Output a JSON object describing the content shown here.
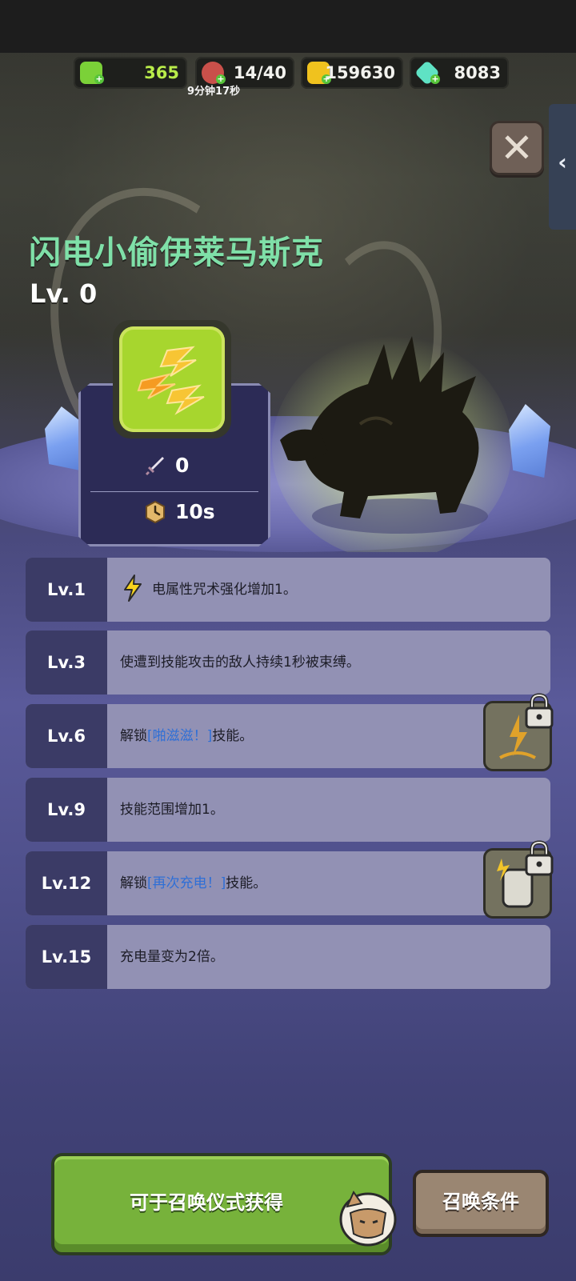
{
  "resources": {
    "energy": {
      "value": "365",
      "icon": "green-energy-icon",
      "color": "#b9ec4a"
    },
    "meat": {
      "value": "14/40",
      "icon": "meat-icon",
      "timer": "9分钟17秒"
    },
    "gold": {
      "value": "159630",
      "icon": "gold-icon"
    },
    "gems": {
      "value": "8083",
      "icon": "gem-icon"
    }
  },
  "close_label": "✕",
  "side_tab_label": "‹",
  "creature": {
    "name": "闪电小偷伊莱马斯克",
    "level": "Lv. 0",
    "skill_icon": "lightning-skill-icon",
    "attack": "0",
    "cooldown": "10s"
  },
  "level_rows": [
    {
      "lv": "Lv.1",
      "text": "电属性咒术强化增加1。",
      "icon": "lightning-icon"
    },
    {
      "lv": "Lv.3",
      "text": "使遭到技能攻击的敌人持续1秒被束缚。"
    },
    {
      "lv": "Lv.6",
      "pre": "解锁",
      "link": "[啪滋滋！]",
      "post": "技能。",
      "locked_icon": "lightning-strike-skill-icon"
    },
    {
      "lv": "Lv.9",
      "text": "技能范围增加1。"
    },
    {
      "lv": "Lv.12",
      "pre": "解锁",
      "link": "[再次充电！]",
      "post": "技能。",
      "locked_icon": "recharge-skill-icon"
    },
    {
      "lv": "Lv.15",
      "text": "充电量变为2倍。"
    }
  ],
  "buttons": {
    "obtain": "可于召唤仪式获得",
    "summon_conditions": "召唤条件"
  },
  "colors": {
    "title": "#7fe0a8",
    "link": "#2f6fd6",
    "row_bg": "#9291b4",
    "row_label_bg": "#3b3b66",
    "cta_green": "#77b23b"
  }
}
